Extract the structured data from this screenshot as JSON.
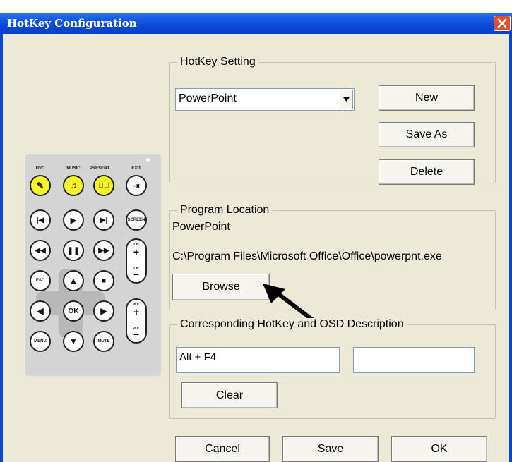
{
  "window": {
    "title": "HotKey Configuration"
  },
  "remote": {
    "top_labels": [
      "DVD",
      "MUSIC",
      "PRESENT",
      "EXIT"
    ],
    "buttons": {
      "screen": "SCREEN",
      "esc": "ESC",
      "ok": "OK",
      "menu": "MENU",
      "mute": "MUTE",
      "ch": "CH",
      "vol": "VOL"
    }
  },
  "hotkey_setting": {
    "legend": "HotKey Setting",
    "selected": "PowerPoint",
    "new_label": "New",
    "save_as_label": "Save As",
    "delete_label": "Delete"
  },
  "program_location": {
    "legend": "Program Location",
    "name": "PowerPoint",
    "path": "C:\\Program Files\\Microsoft Office\\Office\\powerpnt.exe",
    "browse_label": "Browse"
  },
  "hotkey_osd": {
    "legend": "Corresponding HotKey and OSD Description",
    "hotkey_value": "Alt + F4",
    "osd_value": "",
    "clear_label": "Clear"
  },
  "footer": {
    "cancel_label": "Cancel",
    "save_label": "Save",
    "ok_label": "OK"
  }
}
